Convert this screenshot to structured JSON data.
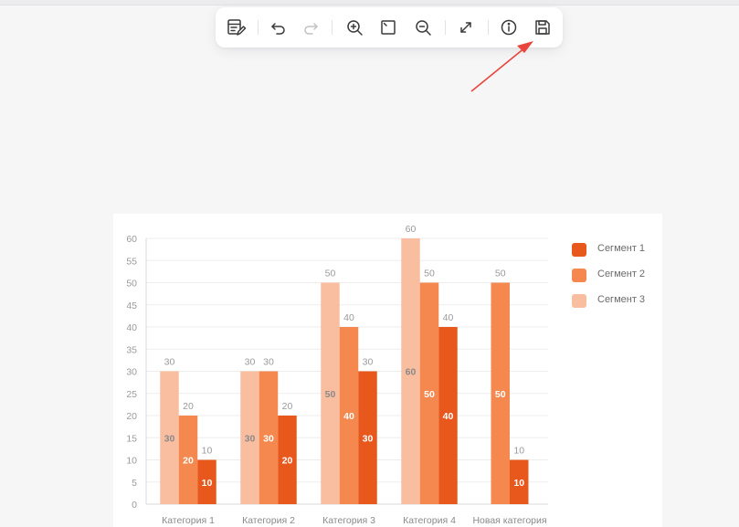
{
  "toolbar": {
    "tools": [
      {
        "name": "edit-data-button",
        "icon": "table-edit-icon"
      },
      {
        "name": "undo-button",
        "icon": "undo-icon"
      },
      {
        "name": "redo-button",
        "icon": "redo-icon"
      },
      {
        "name": "zoom-in-button",
        "icon": "zoom-in-icon"
      },
      {
        "name": "fit-to-screen-button",
        "icon": "fit-frame-icon"
      },
      {
        "name": "zoom-out-button",
        "icon": "zoom-out-icon"
      },
      {
        "name": "fullscreen-button",
        "icon": "expand-arrows-icon"
      },
      {
        "name": "info-button",
        "icon": "info-icon"
      },
      {
        "name": "save-button",
        "icon": "save-icon"
      }
    ],
    "icon_color": "#3a3a3a",
    "disabled_color": "#c2c2c2"
  },
  "annotation": {
    "icon": "red-arrow-icon",
    "color": "#e8453c"
  },
  "chart_data": {
    "type": "bar",
    "categories": [
      "Категория 1",
      "Категория 2",
      "Категория 3",
      "Категория 4",
      "Новая категория"
    ],
    "series": [
      {
        "name": "Сегмент 1",
        "color": "#e8581c",
        "values": [
          10,
          20,
          30,
          40,
          10
        ]
      },
      {
        "name": "Сегмент 2",
        "color": "#f4884f",
        "values": [
          20,
          30,
          40,
          50,
          50
        ]
      },
      {
        "name": "Сегмент 3",
        "color": "#f9bea0",
        "values": [
          30,
          30,
          50,
          60,
          null
        ]
      }
    ],
    "bar_order": [
      "Сегмент 3",
      "Сегмент 2",
      "Сегмент 1"
    ],
    "ylim": [
      0,
      60
    ],
    "yticks": [
      0,
      5,
      10,
      15,
      20,
      25,
      30,
      35,
      40,
      45,
      50,
      55,
      60
    ],
    "grid": true,
    "legend_position": "right",
    "data_labels": "above and inside bars"
  }
}
